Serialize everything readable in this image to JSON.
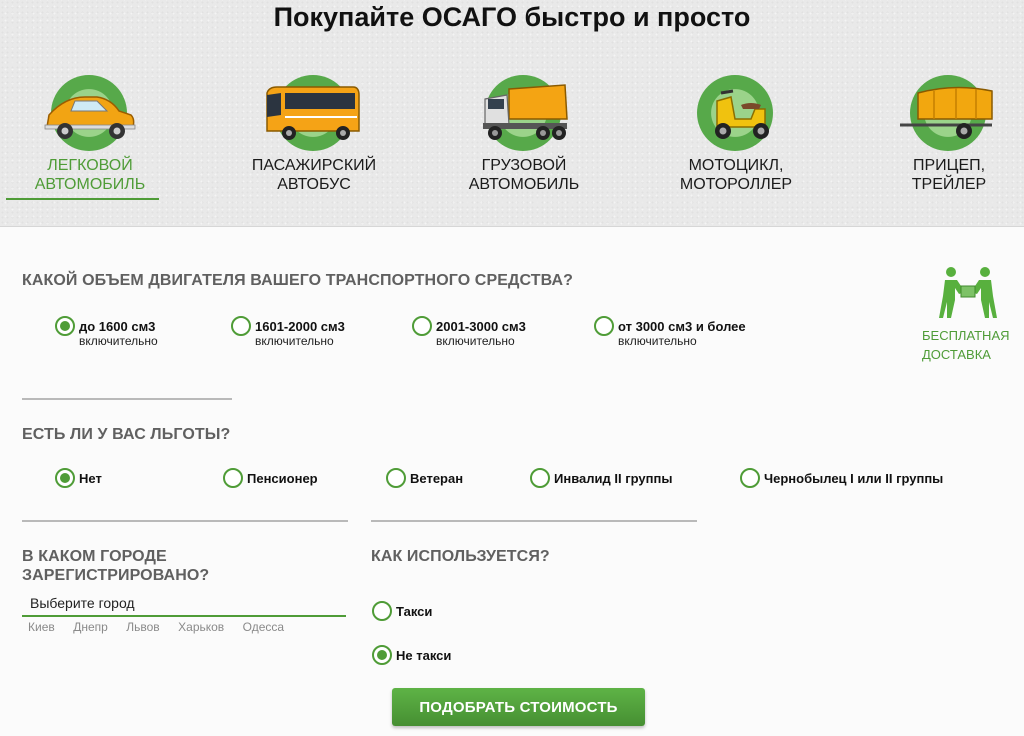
{
  "page": {
    "title": "Покупайте ОСАГО быстро и просто"
  },
  "vehicles": [
    {
      "line1": "ЛЕГКОВОЙ",
      "line2": "АВТОМОБИЛЬ",
      "icon": "car-icon",
      "active": true
    },
    {
      "line1": "ПАСАЖИРСКИЙ",
      "line2": "АВТОБУС",
      "icon": "bus-icon",
      "active": false
    },
    {
      "line1": "ГРУЗОВОЙ",
      "line2": "АВТОМОБИЛЬ",
      "icon": "truck-icon",
      "active": false
    },
    {
      "line1": "МОТОЦИКЛ,",
      "line2": "МОТОРОЛЛЕР",
      "icon": "scooter-icon",
      "active": false
    },
    {
      "line1": "ПРИЦЕП,",
      "line2": "ТРЕЙЛЕР",
      "icon": "trailer-icon",
      "active": false
    }
  ],
  "engine": {
    "question": "КАКОЙ ОБЪЕМ ДВИГАТЕЛЯ ВАШЕГО ТРАНСПОРТНОГО СРЕДСТВА?",
    "options": [
      {
        "label": "до 1600 см3",
        "sub": "включительно",
        "checked": true
      },
      {
        "label": "1601-2000 см3",
        "sub": "включительно",
        "checked": false
      },
      {
        "label": "2001-3000 см3",
        "sub": "включительно",
        "checked": false
      },
      {
        "label": "от 3000 см3 и более",
        "sub": "включительно",
        "checked": false
      }
    ]
  },
  "delivery": {
    "line1": "БЕСПЛАТНАЯ",
    "line2": "ДОСТАВКА",
    "icon": "delivery-handshake-icon"
  },
  "benefits": {
    "question": "ЕСТЬ ЛИ У ВАС ЛЬГОТЫ?",
    "options": [
      {
        "label": "Нет",
        "checked": true
      },
      {
        "label": "Пенсионер",
        "checked": false
      },
      {
        "label": "Ветеран",
        "checked": false
      },
      {
        "label": "Инвалид II группы",
        "checked": false
      },
      {
        "label": "Чернобылец I или II группы",
        "checked": false
      }
    ]
  },
  "city": {
    "question_line1": "В КАКОМ ГОРОДЕ",
    "question_line2": "ЗАРЕГИСТРИРОВАНО?",
    "placeholder": "Выберите город",
    "quick": [
      "Киев",
      "Днепр",
      "Львов",
      "Харьков",
      "Одесса"
    ]
  },
  "usage": {
    "question": "КАК ИСПОЛЬЗУЕТСЯ?",
    "options": [
      {
        "label": "Такси",
        "checked": false
      },
      {
        "label": "Не такси",
        "checked": true
      }
    ]
  },
  "submit": {
    "label": "ПОДОБРАТЬ СТОИМОСТЬ"
  },
  "colors": {
    "accent": "#4f9c37",
    "heading": "#606060",
    "header_bg": "#e9e9e9"
  }
}
